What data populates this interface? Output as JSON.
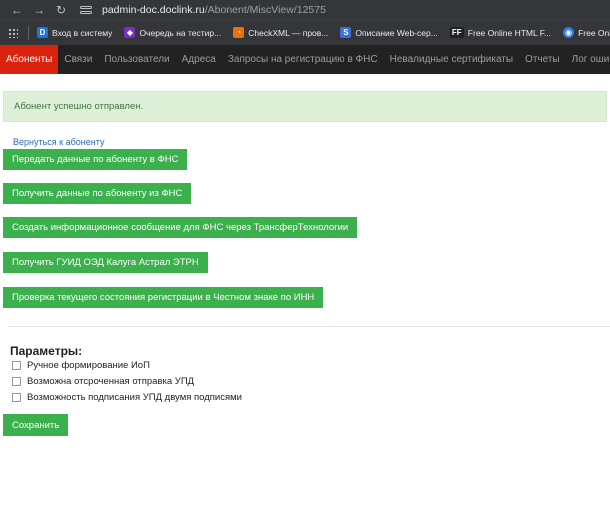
{
  "browser": {
    "url_host": "padmin-doc.doclink.ru",
    "url_path": "/Abonent/MiscView/12575",
    "bookmarks": [
      {
        "label": "Вход в систему",
        "icon": "D",
        "color": "#1a73e8"
      },
      {
        "label": "Очередь на тестир...",
        "icon": "◆",
        "color": "#7b2fbe"
      },
      {
        "label": "CheckXML — пров...",
        "icon": "◔",
        "color": "#e8710a"
      },
      {
        "label": "Описание Web-сер...",
        "icon": "S",
        "color": "#3b6fd6"
      },
      {
        "label": "Free Online HTML F...",
        "icon": "FF",
        "color": "#202124"
      },
      {
        "label": "Free Online GUID G...",
        "icon": "◉",
        "color": "#2b7de9"
      }
    ]
  },
  "nav": {
    "items": [
      {
        "label": "Абоненты",
        "active": true
      },
      {
        "label": "Связи"
      },
      {
        "label": "Пользователи"
      },
      {
        "label": "Адреса"
      },
      {
        "label": "Запросы на регистрацию в ФНС"
      },
      {
        "label": "Невалидные сертификаты"
      },
      {
        "label": "Отчеты"
      },
      {
        "label": "Лог ошибок"
      }
    ]
  },
  "alert": {
    "text": "Абонент успешно отправлен."
  },
  "back_link": "Вернуться к абоненту",
  "actions": [
    {
      "label": "Передать данные по абоненту в ФНС"
    },
    {
      "label": "Получить данные по абоненту из ФНС"
    },
    {
      "label": "Создать информационное сообщение для ФНС через ТрансферТехнологии"
    },
    {
      "label": "Получить ГУИД ОЭД Калуга Астрал ЭТРН"
    },
    {
      "label": "Проверка текущего состояния регистрации в Честном знаке по ИНН"
    }
  ],
  "params": {
    "title": "Параметры:",
    "options": [
      {
        "label": "Ручное формирование ИоП",
        "checked": false
      },
      {
        "label": "Возможна отсроченная отправка УПД",
        "checked": false
      },
      {
        "label": "Возможность подписания УПД двумя подписями",
        "checked": false
      }
    ]
  },
  "save_label": "Сохранить"
}
